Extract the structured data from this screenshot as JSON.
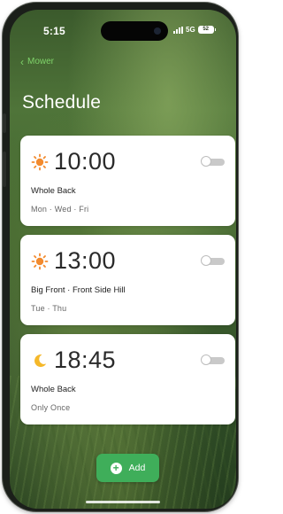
{
  "status_bar": {
    "time": "5:15",
    "network": "5G",
    "battery": "52"
  },
  "nav": {
    "back_label": "Mower"
  },
  "page": {
    "title": "Schedule"
  },
  "schedules": [
    {
      "icon": "sun-icon",
      "time": "10:00",
      "name": "Whole Back",
      "days": "Mon · Wed · Fri",
      "enabled": false
    },
    {
      "icon": "sun-icon",
      "time": "13:00",
      "name": "Big Front · Front Side Hill",
      "days": "Tue · Thu",
      "enabled": false
    },
    {
      "icon": "moon-icon",
      "time": "18:45",
      "name": "Whole Back",
      "days": "Only Once",
      "enabled": false
    }
  ],
  "actions": {
    "add_label": "Add"
  },
  "colors": {
    "accent_green": "#3fae5a",
    "back_link_green": "#7fd36a",
    "sun_orange": "#f28a2e",
    "moon_yellow": "#f5b82a",
    "card_bg": "#ffffff"
  }
}
